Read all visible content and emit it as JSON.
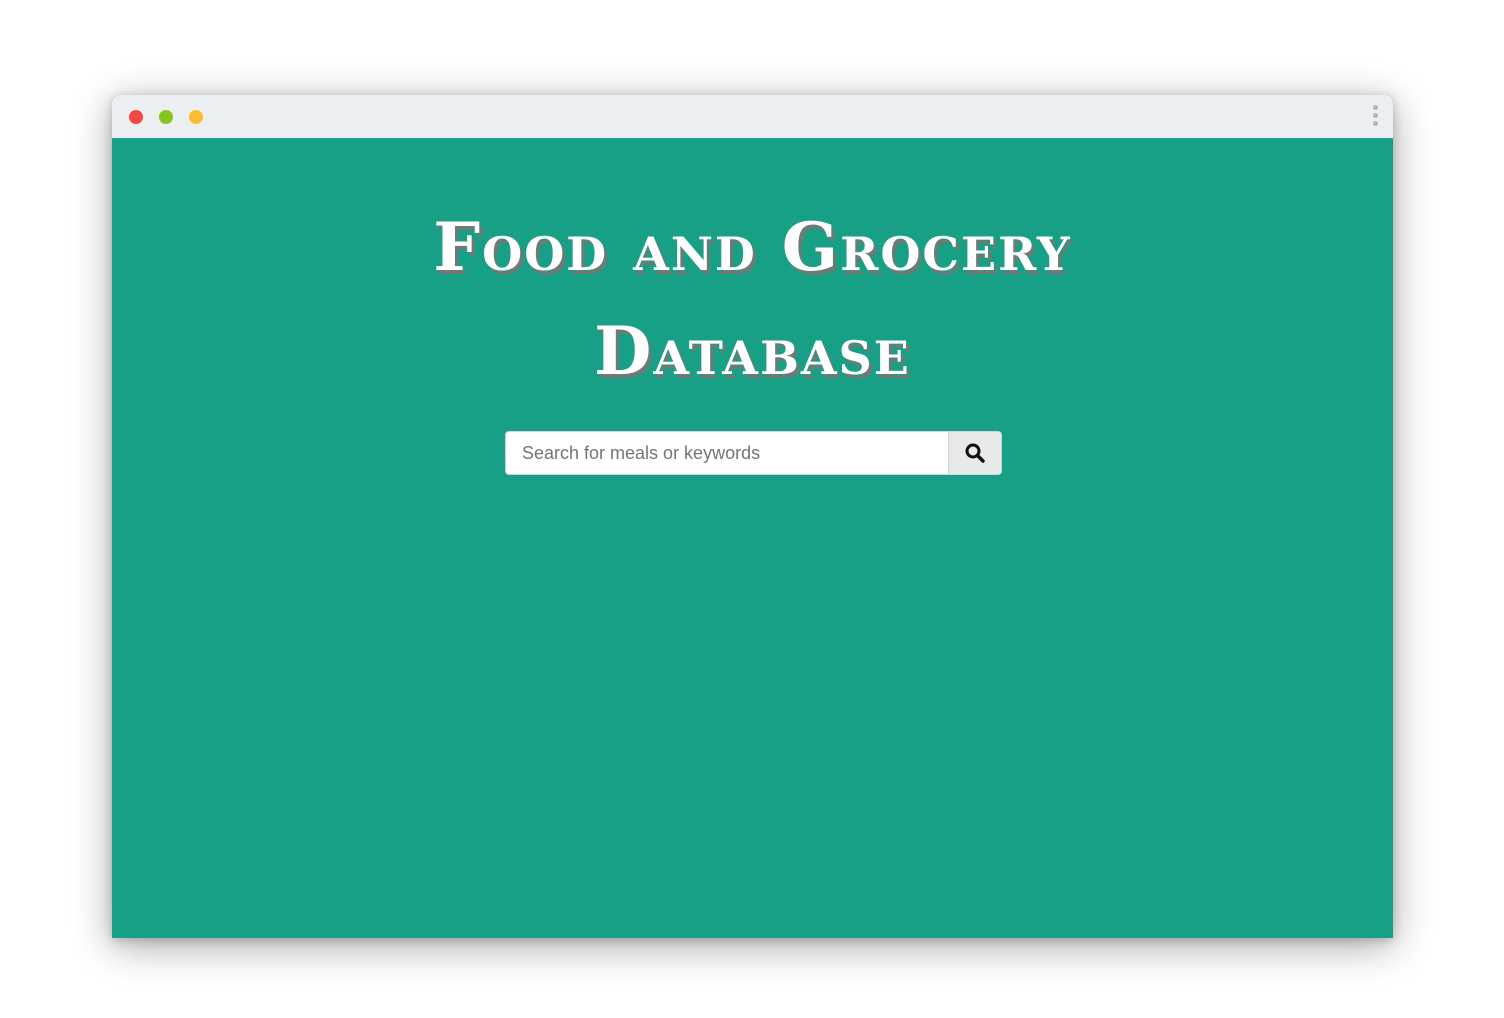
{
  "window": {
    "traffic_lights": {
      "close_color": "#f44646",
      "minimize_color": "#85c51d",
      "maximize_color": "#fbbc2f"
    },
    "menu_icon": "kebab-menu-icon"
  },
  "page": {
    "background_color": "#18a086",
    "title_line1": "Food and Grocery",
    "title_line2": "Database"
  },
  "search": {
    "placeholder": "Search for meals or keywords",
    "value": "",
    "button_icon": "search-icon"
  }
}
